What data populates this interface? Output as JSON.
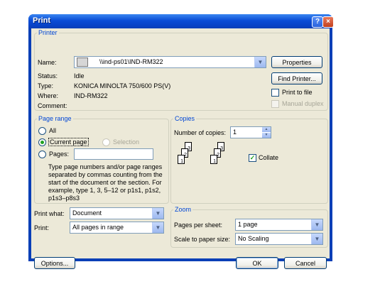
{
  "window": {
    "title": "Print"
  },
  "printer": {
    "group_title": "Printer",
    "name_label": "Name:",
    "name_value": "\\\\ind-ps01\\IND-RM322",
    "status_label": "Status:",
    "status_value": "Idle",
    "type_label": "Type:",
    "type_value": "KONICA MINOLTA 750/600 PS(V)",
    "where_label": "Where:",
    "where_value": "IND-RM322",
    "comment_label": "Comment:",
    "properties_label": "Properties",
    "find_printer_label": "Find Printer...",
    "print_to_file_label": "Print to file",
    "manual_duplex_label": "Manual duplex"
  },
  "page_range": {
    "group_title": "Page range",
    "all_label": "All",
    "current_page_label": "Current page",
    "selection_label": "Selection",
    "pages_label": "Pages:",
    "hint": "Type page numbers and/or page ranges separated by commas counting from the start of the document or the section. For example, type 1, 3, 5–12 or p1s1, p1s2, p1s3–p8s3"
  },
  "copies": {
    "group_title": "Copies",
    "number_label": "Number of copies:",
    "number_value": "1",
    "collate_label": "Collate",
    "page_numbers": [
      "1",
      "2",
      "3"
    ]
  },
  "print_what": {
    "label": "Print what:",
    "value": "Document"
  },
  "print": {
    "label": "Print:",
    "value": "All pages in range"
  },
  "zoom": {
    "group_title": "Zoom",
    "pages_per_sheet_label": "Pages per sheet:",
    "pages_per_sheet_value": "1 page",
    "scale_label": "Scale to paper size:",
    "scale_value": "No Scaling"
  },
  "buttons": {
    "options": "Options...",
    "ok": "OK",
    "cancel": "Cancel"
  },
  "icons": {
    "help": "?",
    "close": "×",
    "dropdown": "▼",
    "up": "▲",
    "down": "▼",
    "check": "✓"
  }
}
